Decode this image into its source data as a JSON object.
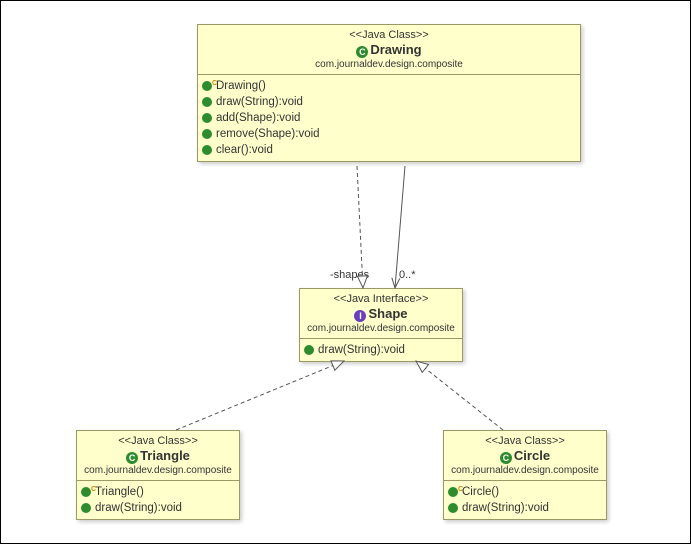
{
  "drawing": {
    "stereotype": "<<Java Class>>",
    "icon_letter": "C",
    "name": "Drawing",
    "package": "com.journaldev.design.composite",
    "members": [
      {
        "sig": "Drawing()",
        "kind": "constructor"
      },
      {
        "sig": "draw(String):void",
        "kind": "method"
      },
      {
        "sig": "add(Shape):void",
        "kind": "method"
      },
      {
        "sig": "remove(Shape):void",
        "kind": "method"
      },
      {
        "sig": "clear():void",
        "kind": "method"
      }
    ]
  },
  "shape": {
    "stereotype": "<<Java Interface>>",
    "icon_letter": "I",
    "name": "Shape",
    "package": "com.journaldev.design.composite",
    "members": [
      {
        "sig": "draw(String):void",
        "kind": "method"
      }
    ]
  },
  "triangle": {
    "stereotype": "<<Java Class>>",
    "icon_letter": "C",
    "name": "Triangle",
    "package": "com.journaldev.design.composite",
    "members": [
      {
        "sig": "Triangle()",
        "kind": "constructor"
      },
      {
        "sig": "draw(String):void",
        "kind": "method"
      }
    ]
  },
  "circle": {
    "stereotype": "<<Java Class>>",
    "icon_letter": "C",
    "name": "Circle",
    "package": "com.journaldev.design.composite",
    "members": [
      {
        "sig": "Circle()",
        "kind": "constructor"
      },
      {
        "sig": "draw(String):void",
        "kind": "method"
      }
    ]
  },
  "assoc": {
    "role": "-shapes",
    "mult": "0..*"
  }
}
